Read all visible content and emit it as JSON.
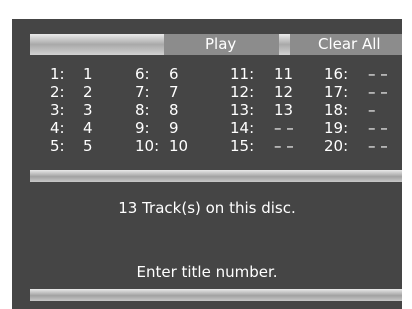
{
  "buttons": {
    "play": "Play",
    "clear_all": "Clear All"
  },
  "tracks": [
    {
      "n": "1:",
      "v": "1"
    },
    {
      "n": "2:",
      "v": "2"
    },
    {
      "n": "3:",
      "v": "3"
    },
    {
      "n": "4:",
      "v": "4"
    },
    {
      "n": "5:",
      "v": "5"
    },
    {
      "n": "6:",
      "v": "6"
    },
    {
      "n": "7:",
      "v": "7"
    },
    {
      "n": "8:",
      "v": "8"
    },
    {
      "n": "9:",
      "v": "9"
    },
    {
      "n": "10:",
      "v": "10"
    },
    {
      "n": "11:",
      "v": "11"
    },
    {
      "n": "12:",
      "v": "12"
    },
    {
      "n": "13:",
      "v": "13"
    },
    {
      "n": "14:",
      "v": "– –"
    },
    {
      "n": "15:",
      "v": "– –"
    },
    {
      "n": "16:",
      "v": "– –"
    },
    {
      "n": "17:",
      "v": "– –"
    },
    {
      "n": "18:",
      "v": "–"
    },
    {
      "n": "19:",
      "v": "– –"
    },
    {
      "n": "20:",
      "v": "– –"
    }
  ],
  "status": {
    "track_count": "13  Track(s) on this disc."
  },
  "prompt": "Enter title number.",
  "colors": {
    "background": "#454545",
    "button": "#8c8c8c",
    "text": "#ffffff"
  }
}
